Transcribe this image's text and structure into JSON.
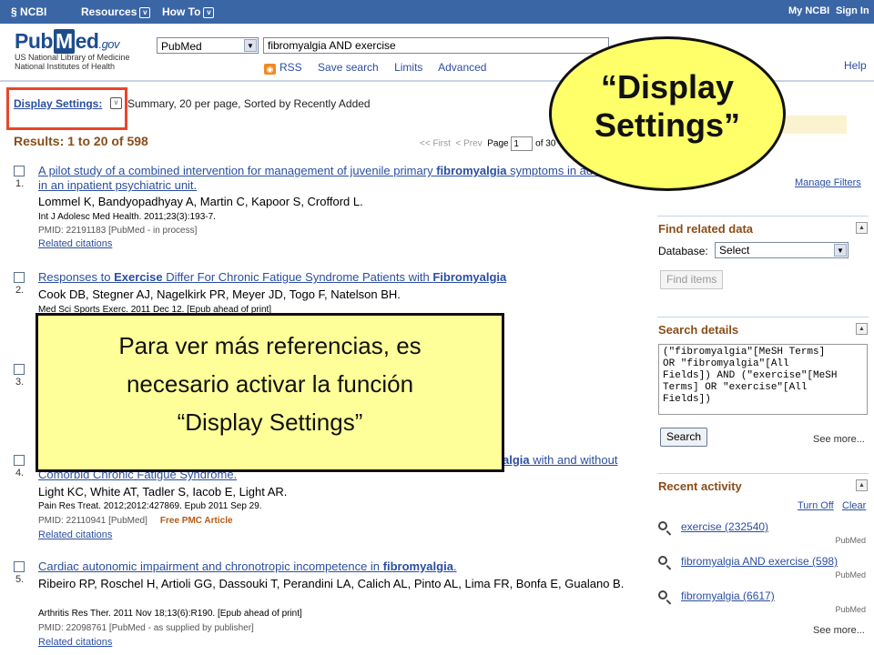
{
  "ncbi_bar": {
    "logo": "NCBI",
    "resources": "Resources",
    "how_to": "How To",
    "my_ncbi": "My NCBI",
    "sign_in": "Sign In"
  },
  "header": {
    "logo_pub": "Pub",
    "logo_m": "M",
    "logo_ed": "ed",
    "logo_gov": ".gov",
    "logo_line1": "US National Library of Medicine",
    "logo_line2": "National Institutes of Health",
    "db_selected": "PubMed",
    "search_value": "fibromyalgia AND exercise",
    "links": {
      "rss": "RSS",
      "save_search": "Save search",
      "limits": "Limits",
      "advanced": "Advanced"
    },
    "help": "Help"
  },
  "display": {
    "link": "Display Settings:",
    "summary": "Summary, 20 per page, Sorted by Recently Added"
  },
  "results": {
    "count": "Results: 1 to 20 of 598",
    "pager_first": "<< First",
    "pager_prev": "< Prev",
    "pager_page": "Page",
    "pager_value": "1",
    "pager_of": "of 30"
  },
  "items": [
    {
      "num": "1.",
      "title_a": "A pilot study of a combined intervention for management of juvenile primary ",
      "title_b": "fibromyalgia",
      "title_c": " symptoms in adolescents in an inpatient psychiatric unit.",
      "authors": "Lommel K, Bandyopadhyay A, Martin C, Kapoor S, Crofford L.",
      "journal": "Int J Adolesc Med Health. 2011;23(3):193-7.",
      "pmid": "PMID: 22191183 [PubMed - in process]",
      "pmc": "",
      "related": "Related citations"
    },
    {
      "num": "2.",
      "title_a": "Responses to ",
      "title_b": "Exercise",
      "title_c": " Differ For Chronic Fatigue Syndrome Patients with ",
      "title_d": "Fibromyalgia",
      "authors": "Cook DB, Stegner AJ, Nagelkirk PR, Meyer JD, Togo F, Natelson BH.",
      "journal": "Med Sci Sports Exerc. 2011 Dec 12. [Epub ahead of print]"
    },
    {
      "num": "3."
    },
    {
      "num": "4.",
      "title_tail_b": "algia",
      "title_tail_c": " with and without",
      "title_line2": "Comorbid Chronic Fatigue Syndrome.",
      "authors": "Light KC, White AT, Tadler S, Iacob E, Light AR.",
      "journal": "Pain Res Treat. 2012;2012:427869. Epub 2011 Sep 29.",
      "pmid": "PMID: 22110941 [PubMed]",
      "pmc": "Free PMC Article",
      "related": "Related citations"
    },
    {
      "num": "5.",
      "title_a": "Cardiac autonomic impairment and chronotropic incompetence in ",
      "title_b": "fibromyalgia",
      "title_c": ".",
      "authors": "Ribeiro RP, Roschel H, Artioli GG, Dassouki T, Perandini LA, Calich AL, Pinto AL, Lima FR, Bonfa E, Gualano B.",
      "journal": "Arthritis Res Ther. 2011 Nov 18;13(6):R190. [Epub ahead of print]",
      "pmid": "PMID: 22098761 [PubMed - as supplied by publisher]",
      "related": "Related citations"
    }
  ],
  "sidebar": {
    "manage_filters": "Manage Filters",
    "find_related": {
      "title": "Find related data",
      "db_label": "Database:",
      "db_value": "Select",
      "button": "Find items"
    },
    "search_details": {
      "title": "Search details",
      "query": "(\"fibromyalgia\"[MeSH Terms]\nOR \"fibromyalgia\"[All\nFields]) AND (\"exercise\"[MeSH\nTerms] OR \"exercise\"[All\nFields])",
      "button": "Search",
      "see_more": "See more..."
    },
    "recent_activity": {
      "title": "Recent activity",
      "turn_off": "Turn Off",
      "clear": "Clear",
      "items": [
        {
          "text": "exercise (232540)",
          "source": "PubMed"
        },
        {
          "text": "fibromyalgia AND exercise (598)",
          "source": "PubMed"
        },
        {
          "text": "fibromyalgia (6617)",
          "source": "PubMed"
        }
      ],
      "see_more": "See more..."
    }
  },
  "callouts": {
    "oval_line1": "“Display",
    "oval_line2": "Settings”",
    "box_line1": "Para ver más referencias, es",
    "box_line2": "necesario activar la función",
    "box_line3": "“Display Settings”"
  },
  "colors": {
    "ncbi_bar": "#3b66a6",
    "link": "#2b4ea0",
    "section_title": "#8a4d18",
    "highlight_box": "#e8462a",
    "callout_yellow": "#ffff99"
  }
}
